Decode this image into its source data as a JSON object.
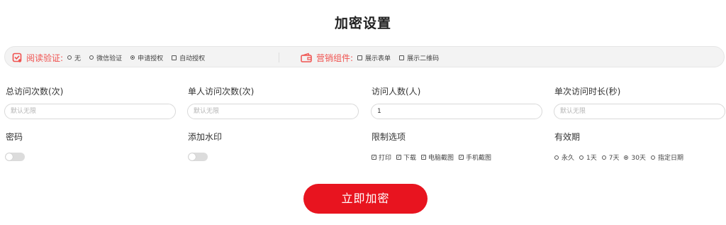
{
  "page_title": "加密设置",
  "toolbar": {
    "read_verify": {
      "icon": "shield-check-icon",
      "label": "阅读验证:",
      "options": [
        {
          "label": "无",
          "selected": false
        },
        {
          "label": "微信验证",
          "selected": false
        },
        {
          "label": "申请授权",
          "selected": true
        }
      ],
      "auto_auth": {
        "label": "自动授权",
        "checked": false
      }
    },
    "marketing": {
      "icon": "wallet-icon",
      "label": "营销组件:",
      "options": [
        {
          "label": "展示表单",
          "checked": false
        },
        {
          "label": "展示二维码",
          "checked": false
        }
      ]
    }
  },
  "fields": {
    "total_visits": {
      "label": "总访问次数(次)",
      "placeholder": "默认无限",
      "value": ""
    },
    "single_visits": {
      "label": "单人访问次数(次)",
      "placeholder": "默认无限",
      "value": ""
    },
    "visitors": {
      "label": "访问人数(人)",
      "placeholder": "",
      "value": "1"
    },
    "single_duration": {
      "label": "单次访问时长(秒)",
      "placeholder": "默认无限",
      "value": ""
    }
  },
  "password": {
    "label": "密码",
    "enabled": false
  },
  "watermark": {
    "label": "添加水印",
    "enabled": false
  },
  "restrictions": {
    "label": "限制选项",
    "options": [
      {
        "label": "打印",
        "checked": true
      },
      {
        "label": "下载",
        "checked": true
      },
      {
        "label": "电脑截图",
        "checked": true
      },
      {
        "label": "手机截图",
        "checked": true
      }
    ]
  },
  "validity": {
    "label": "有效期",
    "options": [
      {
        "label": "永久",
        "selected": false
      },
      {
        "label": "1天",
        "selected": false
      },
      {
        "label": "7天",
        "selected": false
      },
      {
        "label": "30天",
        "selected": true
      },
      {
        "label": "指定日期",
        "selected": false
      }
    ]
  },
  "submit_label": "立即加密",
  "colors": {
    "accent_red": "#e8141f",
    "label_red": "#f0524f",
    "toolbar_bg": "#f3f3f3"
  }
}
